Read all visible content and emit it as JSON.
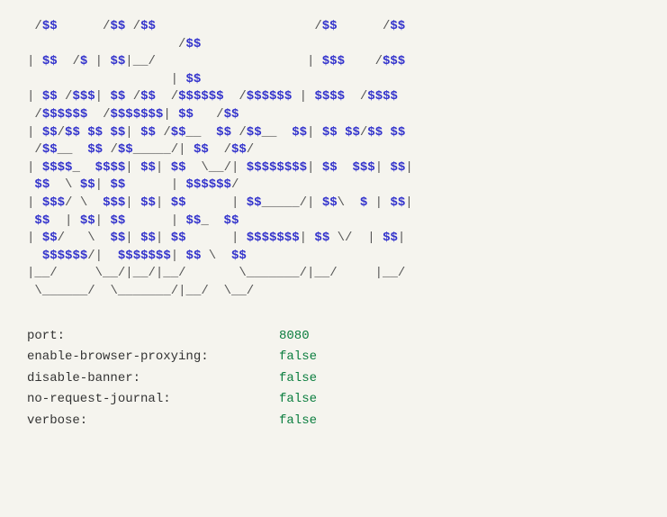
{
  "ascii_lines": [
    " /$$      /$$ /$$                     /$$      /$$",
    "                    /$$",
    "| $$  /$ | $$|__/                    | $$$    /$$$",
    "                   | $$",
    "| $$ /$$$| $$ /$$  /$$$$$$  /$$$$$$ | $$$$  /$$$$",
    " /$$$$$$  /$$$$$$$| $$   /$$",
    "| $$/$$ $$ $$| $$ /$$__  $$ /$$__  $$| $$ $$/$$ $$",
    " /$$__  $$ /$$_____/| $$  /$$/",
    "| $$$$_  $$$$| $$| $$  \\__/| $$$$$$$$| $$  $$$| $$|",
    " $$  \\ $$| $$      | $$$$$$/",
    "| $$$/ \\  $$$| $$| $$      | $$_____/| $$\\  $ | $$|",
    " $$  | $$| $$      | $$_  $$",
    "| $$/   \\  $$| $$| $$      | $$$$$$$| $$ \\/  | $$|",
    "  $$$$$$/|  $$$$$$$| $$ \\  $$",
    "|__/     \\__/|__/|__/       \\_______/|__/     |__/",
    " \\______/  \\_______/|__/  \\__/"
  ],
  "settings": [
    {
      "key": "port:",
      "value": "8080"
    },
    {
      "key": "enable-browser-proxying:",
      "value": "false"
    },
    {
      "key": "disable-banner:",
      "value": "false"
    },
    {
      "key": "no-request-journal:",
      "value": "false"
    },
    {
      "key": "verbose:",
      "value": "false"
    }
  ]
}
